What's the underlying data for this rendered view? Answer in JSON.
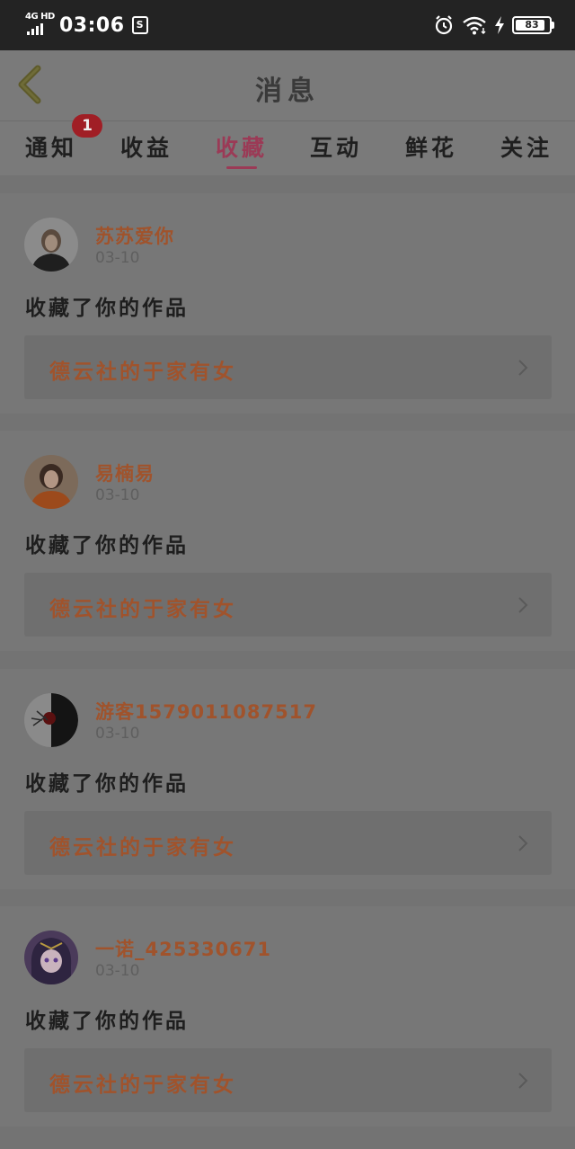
{
  "status_bar": {
    "network": "4G HD",
    "time": "03:06",
    "s_icon": "S",
    "battery": "83",
    "icons": [
      "signal-icon",
      "s-app-icon",
      "alarm-icon",
      "wifi-icon",
      "charging-icon",
      "battery-icon"
    ]
  },
  "header": {
    "title": "消息",
    "back_icon": "back-chevron-icon"
  },
  "tabs": [
    {
      "label": "通知",
      "badge": "1"
    },
    {
      "label": "收益"
    },
    {
      "label": "收藏",
      "active": true
    },
    {
      "label": "互动"
    },
    {
      "label": "鲜花"
    },
    {
      "label": "关注"
    }
  ],
  "feed": [
    {
      "username": "苏苏爱你",
      "date": "03-10",
      "action": "收藏了你的作品",
      "work_title": "德云社的于家有女"
    },
    {
      "username": "易楠易",
      "date": "03-10",
      "action": "收藏了你的作品",
      "work_title": "德云社的于家有女"
    },
    {
      "username": "游客1579011087517",
      "date": "03-10",
      "action": "收藏了你的作品",
      "work_title": "德云社的于家有女"
    },
    {
      "username": "一诺_425330671",
      "date": "03-10",
      "action": "收藏了你的作品",
      "work_title": "德云社的于家有女"
    }
  ],
  "colors": {
    "accent": "#9b3a56",
    "username": "#a0532c",
    "badge": "#a01e25",
    "status_bar": "#232323"
  }
}
